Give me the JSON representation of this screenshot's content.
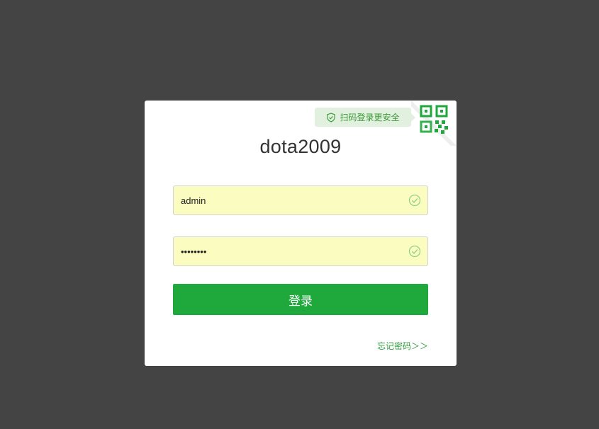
{
  "qr_tip": {
    "label": "扫码登录更安全",
    "icon": "shield-check-icon"
  },
  "qr_corner": {
    "icon": "qr-code-icon"
  },
  "title": "dota2009",
  "form": {
    "username_value": "admin",
    "password_value": "passwo12",
    "field_valid_icon": "check-circle-icon",
    "login_label": "登录",
    "forgot_label": "忘记密码＞＞"
  },
  "colors": {
    "background": "#444444",
    "card": "#ffffff",
    "accent_green": "#1fa83c",
    "field_autofill": "#fafcc0",
    "tip_bg": "#e2f1df"
  }
}
